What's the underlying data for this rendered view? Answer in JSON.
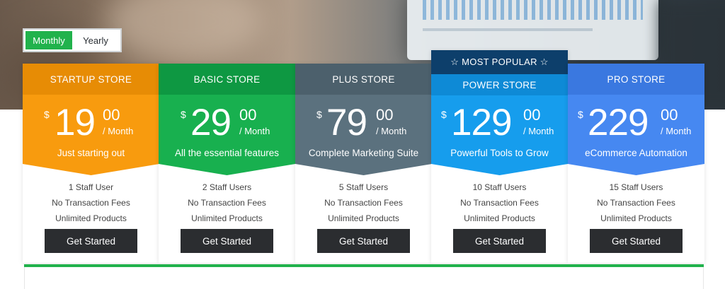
{
  "billing_toggle": {
    "monthly": "Monthly",
    "yearly": "Yearly",
    "selected": "Monthly"
  },
  "plans": [
    {
      "name": "STARTUP STORE",
      "currency": "$",
      "price": "19",
      "cents": "00",
      "period": "/ Month",
      "tagline": "Just starting out",
      "features": [
        "1 Staff User",
        "No Transaction Fees",
        "Unlimited Products"
      ],
      "cta": "Get Started",
      "color": "#f89b0e"
    },
    {
      "name": "BASIC STORE",
      "currency": "$",
      "price": "29",
      "cents": "00",
      "period": "/ Month",
      "tagline": "All the essential features",
      "features": [
        "2 Staff Users",
        "No Transaction Fees",
        "Unlimited Products"
      ],
      "cta": "Get Started",
      "color": "#18b04f"
    },
    {
      "name": "PLUS STORE",
      "currency": "$",
      "price": "79",
      "cents": "00",
      "period": "/ Month",
      "tagline": "Complete Marketing Suite",
      "features": [
        "5 Staff Users",
        "No Transaction Fees",
        "Unlimited Products"
      ],
      "cta": "Get Started",
      "color": "#5b717e"
    },
    {
      "name": "POWER STORE",
      "badge": "☆ MOST POPULAR ☆",
      "currency": "$",
      "price": "129",
      "cents": "00",
      "period": "/ Month",
      "tagline": "Powerful Tools to Grow",
      "features": [
        "10 Staff Users",
        "No Transaction Fees",
        "Unlimited Products"
      ],
      "cta": "Get Started",
      "color": "#169ded"
    },
    {
      "name": "PRO STORE",
      "currency": "$",
      "price": "229",
      "cents": "00",
      "period": "/ Month",
      "tagline": "eCommerce Automation",
      "features": [
        "15 Staff Users",
        "No Transaction Fees",
        "Unlimited Products"
      ],
      "cta": "Get Started",
      "color": "#4688f1"
    }
  ]
}
